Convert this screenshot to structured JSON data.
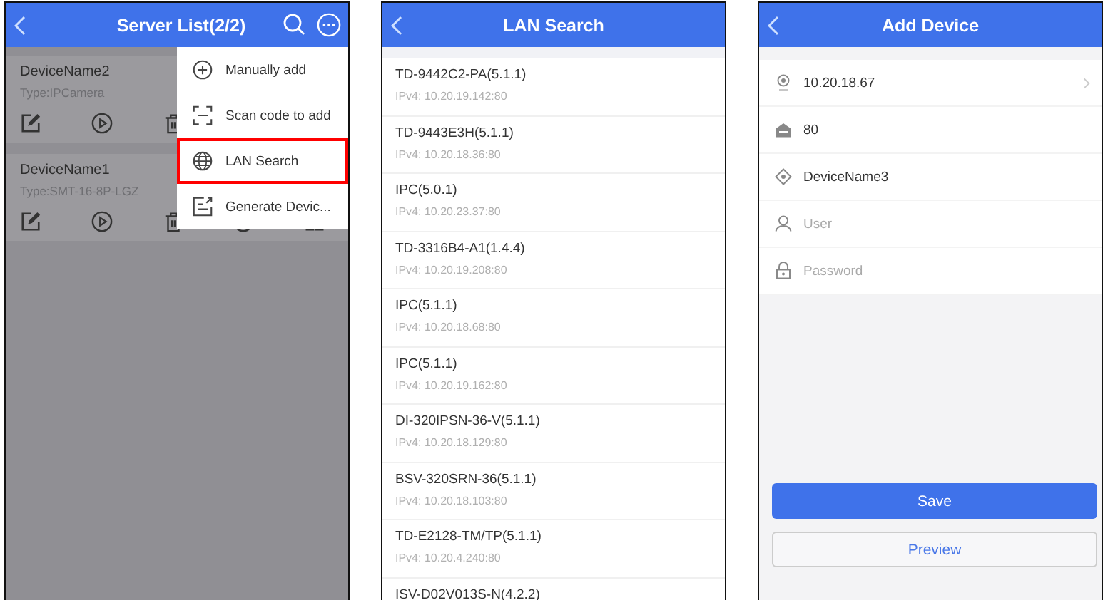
{
  "server_list": {
    "title": "Server List(2/2)",
    "devices": [
      {
        "name": "DeviceName2",
        "type": "Type:IPCamera"
      },
      {
        "name": "DeviceName1",
        "type": "Type:SMT-16-8P-LGZ"
      }
    ],
    "menu": [
      {
        "label": "Manually add",
        "kind": "plus",
        "highlighted": false
      },
      {
        "label": "Scan code to add",
        "kind": "scan",
        "highlighted": false
      },
      {
        "label": "LAN Search",
        "kind": "globe",
        "highlighted": true
      },
      {
        "label": "Generate Devic...",
        "kind": "export",
        "highlighted": false
      }
    ]
  },
  "lan_search": {
    "title": "LAN Search",
    "results": [
      {
        "name": "TD-9442C2-PA(5.1.1)",
        "address": "IPv4: 10.20.19.142:80"
      },
      {
        "name": "TD-9443E3H(5.1.1)",
        "address": "IPv4: 10.20.18.36:80"
      },
      {
        "name": "IPC(5.0.1)",
        "address": "IPv4: 10.20.23.37:80"
      },
      {
        "name": "TD-3316B4-A1(1.4.4)",
        "address": "IPv4: 10.20.19.208:80"
      },
      {
        "name": "IPC(5.1.1)",
        "address": "IPv4: 10.20.18.68:80"
      },
      {
        "name": "IPC(5.1.1)",
        "address": "IPv4: 10.20.19.162:80"
      },
      {
        "name": "DI-320IPSN-36-V(5.1.1)",
        "address": "IPv4: 10.20.18.129:80"
      },
      {
        "name": "BSV-320SRN-36(5.1.1)",
        "address": "IPv4: 10.20.18.103:80"
      },
      {
        "name": "TD-E2128-TM/TP(5.1.1)",
        "address": "IPv4: 10.20.4.240:80"
      },
      {
        "name": "ISV-D02V013S-N(4.2.2)"
      }
    ]
  },
  "add_device": {
    "title": "Add Device",
    "fields": [
      {
        "kind": "address",
        "value": "10.20.18.67",
        "arrow": true
      },
      {
        "kind": "port",
        "value": "80",
        "arrow": false
      },
      {
        "kind": "name",
        "value": "DeviceName3",
        "arrow": false
      },
      {
        "kind": "user",
        "placeholder": "User",
        "arrow": false
      },
      {
        "kind": "password",
        "placeholder": "Password",
        "arrow": false
      }
    ],
    "buttons": [
      {
        "label": "Save",
        "kind": "primary"
      },
      {
        "label": "Preview",
        "kind": "secondary"
      }
    ]
  }
}
